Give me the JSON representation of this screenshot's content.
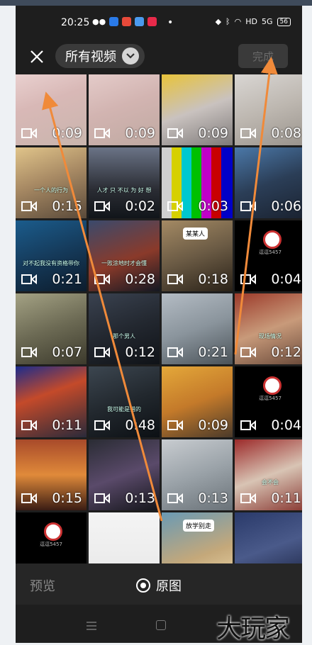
{
  "status_bar": {
    "time": "20:25",
    "dot": "•",
    "hd": "HD",
    "signal": "5G",
    "battery": "56"
  },
  "header": {
    "album_label": "所有视频",
    "done_label": "完成"
  },
  "videos": [
    {
      "duration": "0:09",
      "bg": "linear-gradient(160deg,#e9d0cf 0%,#d8b8b6 40%,#c9b5ad 100%)"
    },
    {
      "duration": "0:09",
      "bg": "linear-gradient(160deg,#e4cbc9 0%,#d2b4b1 45%,#bfa9a1 100%)"
    },
    {
      "duration": "0:09",
      "bg": "linear-gradient(160deg,#e8c33a 0%,#c9c2bf 50%,#7e7a79 100%)"
    },
    {
      "duration": "0:08",
      "bg": "linear-gradient(160deg,#d9d6d3 0%,#bdb7b0 50%,#99938c 100%)"
    },
    {
      "duration": "0:15",
      "bg": "linear-gradient(160deg,#e0c48a 0%,#a88a64 45%,#5a4a3a 100%)",
      "caption": "一个人的行为"
    },
    {
      "duration": "0:02",
      "bg": "linear-gradient(180deg,#6a7386 0%,#2a2c33 60%,#11151a 100%)",
      "caption": "人才 只 不以 为 好 想"
    },
    {
      "duration": "0:03",
      "bg": "linear-gradient(90deg,#cfcfcf 0 14%,#d6d000 14% 28%,#00c8cf 28% 42%,#00c000 42% 56%,#c000c8 56% 70%,#c80000 70% 84%,#0000c8 84% 100%)"
    },
    {
      "duration": "0:06",
      "bg": "linear-gradient(160deg,#4b78a8 0%,#2b3e57 50%,#1a2230 100%)"
    },
    {
      "duration": "0:21",
      "bg": "linear-gradient(160deg,#1b5c8c 0%,#153a5a 50%,#0c1c2c 100%)",
      "caption": "对不起我没有资格带你"
    },
    {
      "duration": "0:28",
      "bg": "linear-gradient(160deg,#3a4a6c 0%,#8a3a2a 55%,#141822 100%)",
      "caption": "一败涂地时才会懂"
    },
    {
      "duration": "0:18",
      "bg": "linear-gradient(160deg,#a48a64 0%,#6a5a44 50%,#2a2218 100%)",
      "badge": "某某人"
    },
    {
      "duration": "0:04",
      "bg": "#000000",
      "logo": true,
      "logo_caption": "逗逗5457"
    },
    {
      "duration": "0:07",
      "bg": "linear-gradient(160deg,#a4a284 0%,#6c6a54 50%,#3c3a2c 100%)"
    },
    {
      "duration": "0:12",
      "bg": "linear-gradient(160deg,#3a4250 0%,#232830 50%,#101318 100%)",
      "caption": "那个男人"
    },
    {
      "duration": "0:21",
      "bg": "linear-gradient(160deg,#b4bcc4 0%,#8a949c 50%,#4a5258 100%)"
    },
    {
      "duration": "0:12",
      "bg": "linear-gradient(160deg,#9c3a2a 0%,#c89a7a 50%,#6a4a3a 100%)",
      "caption": "现场情况"
    },
    {
      "duration": "0:11",
      "bg": "linear-gradient(160deg,#1c2c8c 0%,#c44a2a 40%,#2a2a3a 100%)"
    },
    {
      "duration": "0:48",
      "bg": "linear-gradient(160deg,#3c4650 0%,#22282e 50%,#0c1014 100%)",
      "caption": "我可能是错的"
    },
    {
      "duration": "0:09",
      "bg": "linear-gradient(160deg,#e4a83a 0%,#c47a2a 50%,#4a3a2a 100%)"
    },
    {
      "duration": "0:04",
      "bg": "#000000",
      "logo": true,
      "logo_caption": "逗逗5457"
    },
    {
      "duration": "0:15",
      "bg": "linear-gradient(180deg,#a84a2a 0%,#e08a3a 50%,#3a1c14 100%)"
    },
    {
      "duration": "0:13",
      "bg": "linear-gradient(160deg,#2a2c34 0%,#5a4a6a 50%,#14151a 100%)"
    },
    {
      "duration": "0:13",
      "bg": "linear-gradient(160deg,#c8ccd0 0%,#9aa2a8 50%,#6a7278 100%)"
    },
    {
      "duration": "0:11",
      "bg": "linear-gradient(160deg,#9c2a2a 0%,#d8c4b4 50%,#8a3a34 100%)",
      "caption": "会不会"
    },
    {
      "duration": "",
      "bg": "#000000",
      "logo": true,
      "logo_caption": "逗逗5457"
    },
    {
      "duration": "",
      "bg": "linear-gradient(180deg,#f4f4f4 0%,#e8e8e8 100%)"
    },
    {
      "duration": "",
      "bg": "linear-gradient(160deg,#6a9ab4 0%,#c4a87a 60%,#e8d2a4 100%)",
      "badge": "放学别走"
    },
    {
      "duration": "",
      "bg": "linear-gradient(160deg,#2a3a6a 0%,#4a5a8a 50%,#1a2240 100%)"
    }
  ],
  "bottom": {
    "preview_label": "预览",
    "original_label": "原图"
  },
  "watermark": "大玩家",
  "colors": {
    "arrow": "#f08a3a",
    "background": "#1e1e1e"
  }
}
